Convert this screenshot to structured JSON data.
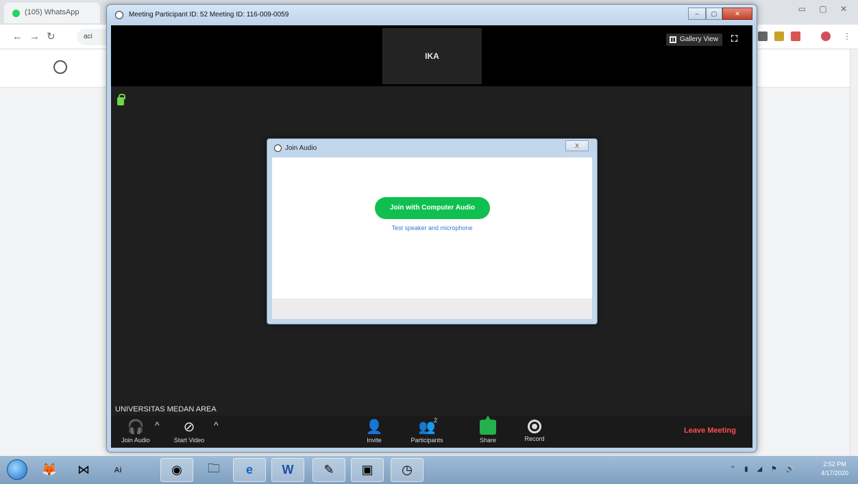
{
  "browser": {
    "tab_title": "(105) WhatsApp",
    "address_fragment": "aci"
  },
  "zoom_window": {
    "title": "Meeting Participant ID: 52   Meeting ID: 116-009-0059",
    "participant_tile_name": "IKA",
    "gallery_view_label": "Gallery View",
    "self_name": "UNIVERSITAS MEDAN AREA",
    "toolbar": {
      "join_audio": "Join Audio",
      "start_video": "Start Video",
      "invite": "Invite",
      "participants": "Participants",
      "participants_count": "2",
      "share": "Share",
      "record": "Record",
      "leave": "Leave Meeting"
    }
  },
  "join_audio_dialog": {
    "title": "Join Audio",
    "close_label": "X",
    "join_button": "Join with Computer Audio",
    "test_link": "Test speaker and microphone"
  },
  "taskbar": {
    "clock_time": "2:52 PM",
    "clock_date": "4/17/2020"
  }
}
